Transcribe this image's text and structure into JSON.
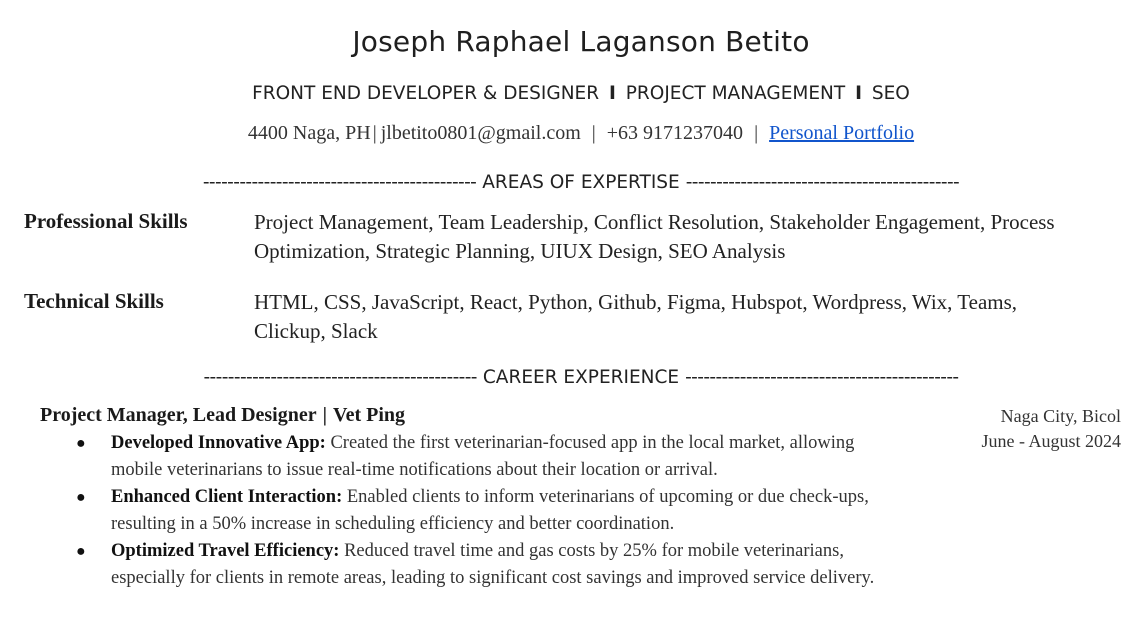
{
  "header": {
    "name": "Joseph Raphael Laganson Betito",
    "roles": [
      "FRONT END DEVELOPER & DESIGNER",
      "PROJECT MANAGEMENT",
      "SEO"
    ],
    "role_separator": "I",
    "contact": {
      "location": "4400 Naga, PH",
      "email": "jlbetito0801@gmail.com",
      "phone": "+63 9171237040",
      "portfolio_label": "Personal Portfolio",
      "separator": "|"
    }
  },
  "sections": {
    "expertise": {
      "dashes": "---------------------------------------------",
      "title": "AREAS OF EXPERTISE"
    },
    "career": {
      "dashes": "---------------------------------------------",
      "title": "CAREER EXPERIENCE"
    }
  },
  "skills": [
    {
      "label": "Professional Skills",
      "text": "Project Management, Team Leadership, Conflict Resolution, Stakeholder Engagement, Process Optimization, Strategic Planning, UIUX Design, SEO Analysis"
    },
    {
      "label": "Technical Skills",
      "text": "HTML, CSS, JavaScript, React, Python, Github, Figma, Hubspot, Wordpress, Wix, Teams, Clickup, Slack"
    }
  ],
  "experience": [
    {
      "role": "Project Manager, Lead Designer",
      "separator": "|",
      "company": "Vet Ping",
      "location": "Naga City, Bicol",
      "dates": "June - August 2024",
      "bullet_symbol": "●",
      "bullets": [
        {
          "head": "Developed Innovative App:",
          "text": "Created the first veterinarian-focused app in the local market, allowing mobile veterinarians to issue real-time notifications about their location or arrival."
        },
        {
          "head": "Enhanced Client Interaction:",
          "text": "Enabled clients to inform veterinarians of upcoming or due check-ups, resulting in a 50% increase in scheduling efficiency and better coordination."
        },
        {
          "head": "Optimized Travel Efficiency:",
          "text": "Reduced travel time and gas costs by 25% for mobile veterinarians, especially for clients in remote areas, leading to significant cost savings and improved service delivery."
        }
      ]
    }
  ]
}
